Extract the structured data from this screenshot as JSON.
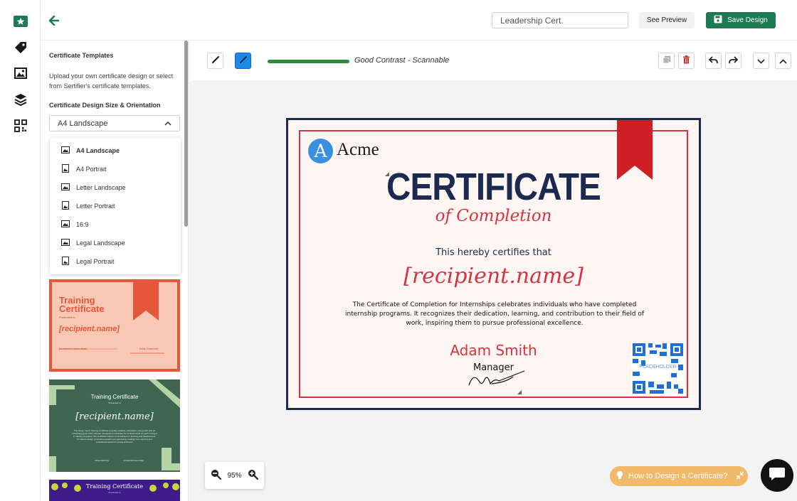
{
  "rail": {
    "icons": [
      "certificate-star-icon",
      "tag-icon",
      "image-icon",
      "layers-icon",
      "qr-grid-icon"
    ]
  },
  "topbar": {
    "back_icon": "arrow-left-icon",
    "cert_name_value": "Leadership Cert.",
    "preview_label": "See Preview",
    "save_label": "Save Design"
  },
  "panel": {
    "title": "Certificate Templates",
    "description": "Upload your own certificate design or select from Sertifier's certificate templates.",
    "size_label": "Certificate Design Size & Orientation",
    "size_value": "A4 Landscape",
    "options": [
      {
        "label": "A4 Landscape",
        "icon": "landscape-icon",
        "selected": true
      },
      {
        "label": "A4 Portrait",
        "icon": "portrait-icon",
        "selected": false
      },
      {
        "label": "Letter Landscape",
        "icon": "landscape-icon",
        "selected": false
      },
      {
        "label": "Letter Portrait",
        "icon": "portrait-icon",
        "selected": false
      },
      {
        "label": "16:9",
        "icon": "landscape-icon",
        "selected": false
      },
      {
        "label": "Legal Landscape",
        "icon": "landscape-icon",
        "selected": false
      },
      {
        "label": "Legal Portrait",
        "icon": "portrait-icon",
        "selected": false
      }
    ],
    "templates": [
      {
        "title_line1": "Training",
        "title_line2": "Certificate",
        "presented": "Presented to",
        "name": "[recipient.name]",
        "footer_left": "[credential.issue.date]",
        "footer_right": "Kelly Cannonb"
      },
      {
        "title": "Training Certificate",
        "presented": "Presented to",
        "name": "[recipient.name]",
        "body": "The Green Youth Training Certificate template radiates enthusiasm and growth with its refreshing green color scheme. Designed to celebrate the achievements of youth involved in training programs, this certificate reflects a commitment to learning and development. Its vibrant design symbolizes growth and opportunity, making it an inspiring and motivational award for young achievers.",
        "footer_left": "Olivia Hastings",
        "footer_right": "[credential.issue.date]"
      },
      {
        "title": "Training Certificate",
        "presented": "Presented to"
      }
    ]
  },
  "toolbar": {
    "contrast_text": "Good Contrast - Scannable",
    "contrast_level": 1.0
  },
  "certificate": {
    "logo_letter": "A",
    "logo_text": "Acme",
    "heading": "CERTIFICATE",
    "subheading": "of Completion",
    "certifies": "This hereby certifies that",
    "recipient": "[recipient.name]",
    "body": "The Certificate of Completion for Internships celebrates individuals who have completed internship programs. It recognizes their dedication, learning, and contribution to their field of work, inspiring them to pursue professional excellence.",
    "signer_name": "Adam Smith",
    "signer_title": "Manager",
    "qr_label": "PLACEHOLDER"
  },
  "zoom": {
    "value": "95%"
  },
  "help": {
    "label": "How to Design a Certificate?"
  },
  "colors": {
    "brand_green": "#1d7a54",
    "navy": "#1b2a4e",
    "cert_red": "#d93240",
    "ribbon_red": "#cf1f25",
    "help_orange": "#f2b96a"
  }
}
